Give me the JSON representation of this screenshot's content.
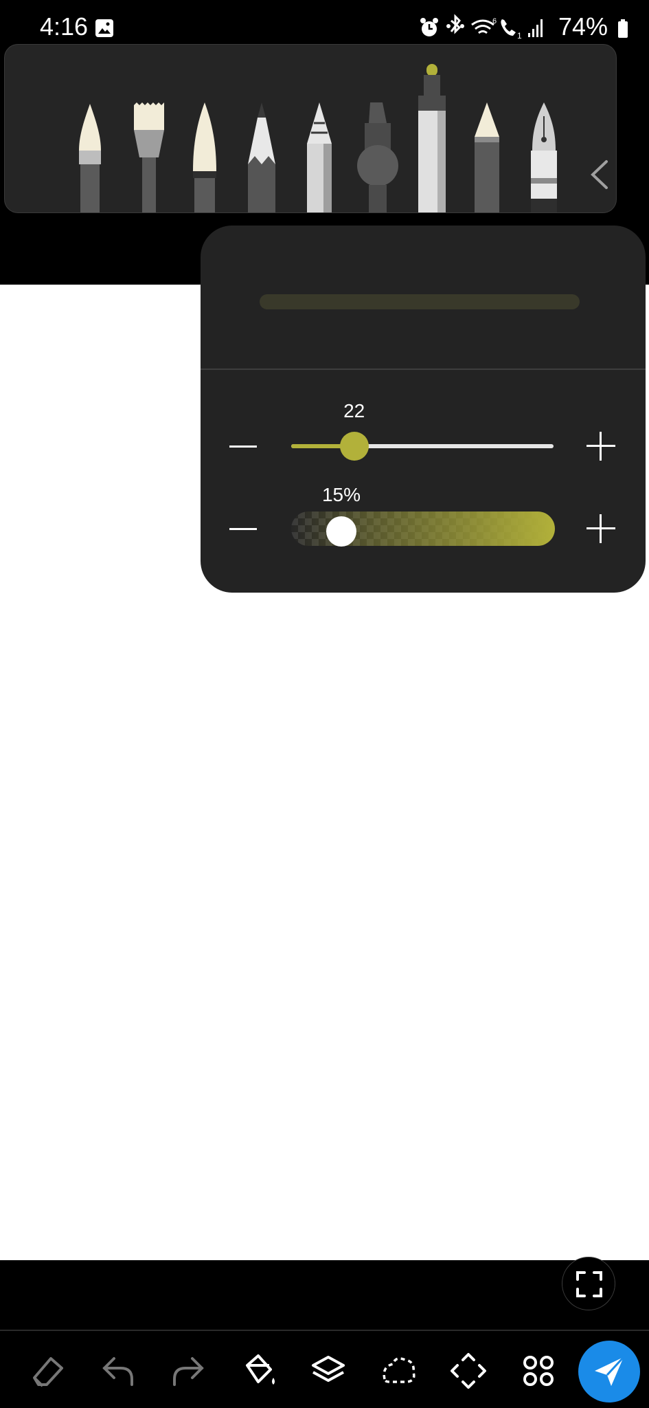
{
  "status_bar": {
    "time": "4:16",
    "battery_percent": "74%",
    "icons": [
      "gallery-icon",
      "alarm-icon",
      "bluetooth-icon",
      "wifi-icon",
      "call-icon",
      "signal-icon",
      "battery-icon"
    ]
  },
  "pen_tray": {
    "pens": [
      "brush",
      "flat-brush",
      "calligraphy-pen",
      "pencil",
      "charcoal-pencil",
      "airbrush",
      "marker",
      "crayon",
      "fountain-pen"
    ],
    "selected_pen": "marker",
    "collapse_icon": "chevron-left-icon"
  },
  "pen_settings": {
    "size": {
      "value": "22",
      "level": 0.24
    },
    "opacity": {
      "value": "15%",
      "level": 0.15
    },
    "color": "#b2b13a"
  },
  "toolbar": {
    "tools": [
      "eraser",
      "undo",
      "redo",
      "fill",
      "layers",
      "lasso",
      "transform",
      "more"
    ],
    "send_button_color": "#1a8be8"
  }
}
